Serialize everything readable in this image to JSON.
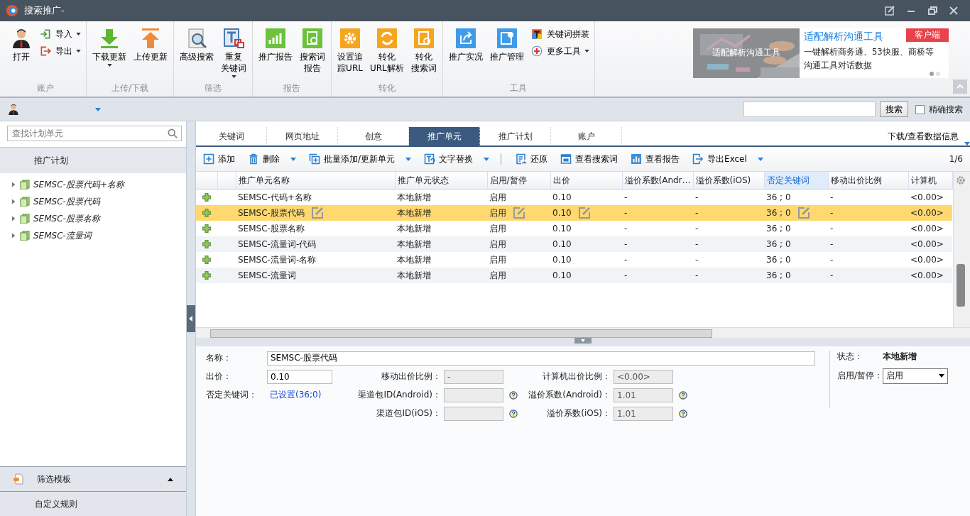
{
  "window": {
    "title": "搜索推广-"
  },
  "ribbon": {
    "groups": [
      {
        "label": "账户",
        "buttons": [
          {
            "label": "打开",
            "kind": "big",
            "caret": false
          },
          {
            "label": "导入",
            "kind": "small",
            "caret": true
          },
          {
            "label": "导出",
            "kind": "small",
            "caret": true
          }
        ]
      },
      {
        "label": "上传/下载",
        "buttons": [
          {
            "label": "下载更新",
            "kind": "big",
            "caret": true
          },
          {
            "label": "上传更新",
            "kind": "big",
            "caret": false
          }
        ]
      },
      {
        "label": "筛选",
        "buttons": [
          {
            "label": "高级搜索",
            "kind": "big",
            "caret": false
          },
          {
            "lines": [
              "重复",
              "关键词"
            ],
            "kind": "big",
            "caret": true
          }
        ]
      },
      {
        "label": "报告",
        "buttons": [
          {
            "label": "推广报告",
            "kind": "big",
            "caret": false
          },
          {
            "lines": [
              "搜索词",
              "报告"
            ],
            "kind": "big",
            "caret": false
          }
        ]
      },
      {
        "label": "转化",
        "buttons": [
          {
            "lines": [
              "设置追",
              "踪URL"
            ],
            "kind": "big",
            "caret": false
          },
          {
            "lines": [
              "转化",
              "URL解析"
            ],
            "kind": "big",
            "caret": false
          },
          {
            "lines": [
              "转化",
              "搜索词"
            ],
            "kind": "big",
            "caret": false
          }
        ]
      },
      {
        "label": "工具",
        "buttons": [
          {
            "label": "推广实况",
            "kind": "big",
            "caret": false
          },
          {
            "label": "推广管理",
            "kind": "big",
            "caret": false
          },
          {
            "label": "关键词拼装",
            "kind": "small",
            "caret": false
          },
          {
            "label": "更多工具",
            "kind": "small",
            "caret": true
          }
        ]
      }
    ]
  },
  "banner": {
    "kind": "picture",
    "overlay": "适配解析沟通工具",
    "title": "适配解析沟通工具",
    "badge": "客户端",
    "description": "一键解析商务通、53快服、商桥等沟通工具对话数据",
    "dots": [
      {
        "selected": true
      },
      {
        "selected": false
      }
    ]
  },
  "search": {
    "button": "搜索",
    "exact": {
      "label": "精确搜索",
      "checked": false
    }
  },
  "sidebar": {
    "placeholder": "查找计划单元",
    "header": "推广计划",
    "items": [
      {
        "label": "SEMSC-股票代码+名称",
        "expanded": false
      },
      {
        "label": "SEMSC-股票代码",
        "expanded": false
      },
      {
        "label": "SEMSC-股票名称",
        "expanded": false
      },
      {
        "label": "SEMSC-流量词",
        "expanded": false
      }
    ],
    "footer": [
      {
        "label": "筛选模板"
      },
      {
        "label": "自定义规则"
      }
    ]
  },
  "tabs": [
    {
      "label": "关键词",
      "selected": false
    },
    {
      "label": "网页地址",
      "selected": false
    },
    {
      "label": "创意",
      "selected": false
    },
    {
      "label": "推广单元",
      "selected": true
    },
    {
      "label": "推广计划",
      "selected": false
    },
    {
      "label": "账户",
      "selected": false
    }
  ],
  "tabs_menu": "下载/查看数据信息",
  "toolbar": {
    "groups": [
      [
        {
          "label": "添加",
          "caret": false
        },
        {
          "label": "删除",
          "caret": true
        },
        {
          "label": "批量添加/更新单元",
          "caret": true
        },
        {
          "label": "文字替换",
          "caret": true
        }
      ],
      [
        {
          "label": "还原",
          "caret": false
        },
        {
          "label": "查看搜索词",
          "caret": false
        },
        {
          "label": "查看报告",
          "caret": false
        },
        {
          "label": "导出Excel",
          "caret": true
        }
      ]
    ],
    "page": "1/6"
  },
  "table": {
    "columns": [
      {
        "label": "推广单元名称",
        "editable": true,
        "sorted": false
      },
      {
        "label": "推广单元状态",
        "editable": false,
        "sorted": false
      },
      {
        "label": "启用/暂停",
        "editable": true,
        "sorted": false
      },
      {
        "label": "出价",
        "editable": true,
        "sorted": false
      },
      {
        "label": "溢价系数(Andr…",
        "editable": false,
        "sorted": false
      },
      {
        "label": "溢价系数(iOS)",
        "editable": false,
        "sorted": false
      },
      {
        "label": "否定关键词",
        "editable": true,
        "sorted": true
      },
      {
        "label": "移动出价比例",
        "editable": false,
        "sorted": false
      },
      {
        "label": "计算机",
        "editable": false,
        "sorted": false
      }
    ],
    "rows": [
      {
        "selected": false,
        "cells": [
          "SEMSC-代码+名称",
          "本地新增",
          "启用",
          "0.10",
          "-",
          "-",
          "36 ; 0",
          "-",
          "<0.00>"
        ]
      },
      {
        "selected": true,
        "cells": [
          "SEMSC-股票代码",
          "本地新增",
          "启用",
          "0.10",
          "-",
          "-",
          "36 ; 0",
          "-",
          "<0.00>"
        ]
      },
      {
        "selected": false,
        "cells": [
          "SEMSC-股票名称",
          "本地新增",
          "启用",
          "0.10",
          "-",
          "-",
          "36 ; 0",
          "-",
          "<0.00>"
        ]
      },
      {
        "selected": false,
        "cells": [
          "SEMSC-流量词-代码",
          "本地新增",
          "启用",
          "0.10",
          "-",
          "-",
          "36 ; 0",
          "-",
          "<0.00>"
        ]
      },
      {
        "selected": false,
        "cells": [
          "SEMSC-流量词-名称",
          "本地新增",
          "启用",
          "0.10",
          "-",
          "-",
          "36 ; 0",
          "-",
          "<0.00>"
        ]
      },
      {
        "selected": false,
        "cells": [
          "SEMSC-流量词",
          "本地新增",
          "启用",
          "0.10",
          "-",
          "-",
          "36 ; 0",
          "-",
          "<0.00>"
        ]
      }
    ]
  },
  "detail": {
    "name": {
      "label": "名称：",
      "value": "SEMSC-股票代码"
    },
    "fields": [
      {
        "label": "出价：",
        "value": "0.10",
        "kind": "input",
        "help": false
      },
      {
        "label": "移动出价比例：",
        "value": "-",
        "kind": "disabled",
        "help": false
      },
      {
        "label": "计算机出价比例：",
        "value": "<0.00>",
        "kind": "disabled",
        "help": false
      },
      {
        "label": "否定关键词：",
        "value": "已设置(36;0)",
        "kind": "link",
        "help": false
      },
      {
        "label": "渠道包ID(Android)：",
        "kind": "disabled",
        "help": true
      },
      {
        "label": "溢价系数(Android)：",
        "value": "1.01",
        "kind": "disabled",
        "help": true
      },
      {
        "label": "渠道包ID(iOS)：",
        "kind": "disabled",
        "help": true
      },
      {
        "label": "溢价系数(iOS)：",
        "value": "1.01",
        "kind": "disabled",
        "help": true
      }
    ],
    "status": {
      "label": "状态：",
      "value": "本地新增"
    },
    "toggle": {
      "label": "启用/暂停：",
      "value": "启用"
    }
  }
}
